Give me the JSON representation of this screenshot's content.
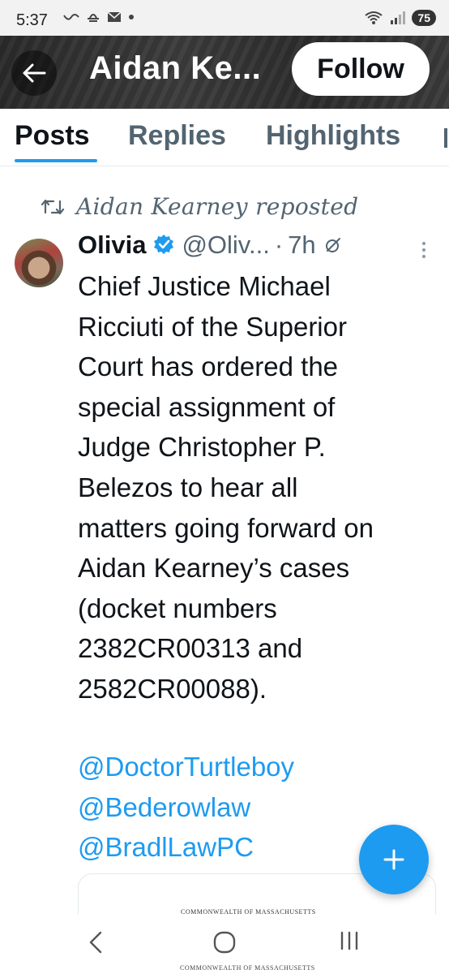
{
  "status_bar": {
    "time": "5:37",
    "battery": "75",
    "signal_label": "5"
  },
  "header": {
    "title": "Aidan Ke...",
    "follow_label": "Follow"
  },
  "tabs": [
    {
      "label": "Posts",
      "active": true
    },
    {
      "label": "Replies",
      "active": false
    },
    {
      "label": "Highlights",
      "active": false
    }
  ],
  "tweet": {
    "repost_text": "Aidan Kearney reposted",
    "author_name": "Olivia",
    "handle": "@Oliv...",
    "separator": "·",
    "time": "7h",
    "body_lines": [
      "Chief Justice Michael",
      "Ricciuti of the Superior",
      "Court has ordered the",
      "special assignment of",
      "Judge Christopher P.",
      "Belezos to hear all",
      "matters going forward on",
      "Aidan Kearney’s cases",
      "(docket numbers",
      "2382CR00313 and",
      "2582CR00088)."
    ],
    "mentions": [
      "@DoctorTurtleboy",
      "@Bederowlaw",
      "@BradlLawPC"
    ],
    "attachment_heading": "COMMONWEALTH OF MASSACHUSETTS"
  },
  "fab_label": "+",
  "nav": {
    "sub_text": "COMMONWEALTH OF MASSACHUSETTS"
  },
  "colors": {
    "accent": "#1d9bf0",
    "text_primary": "#0f1419",
    "text_secondary": "#536471"
  }
}
